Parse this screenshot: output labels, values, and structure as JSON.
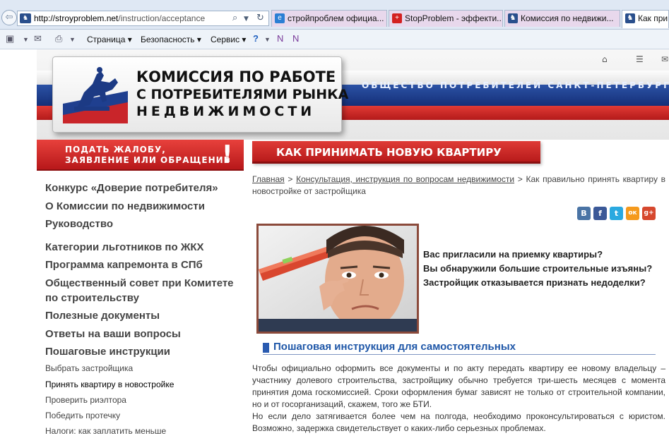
{
  "browser": {
    "address": {
      "url_domain": "http://stroyproblem.net",
      "url_path": "/instruction/acceptance"
    },
    "tabs": [
      {
        "label": "стройпроблем официа...",
        "icon": "ie-icon",
        "color": "#e8d8ec"
      },
      {
        "label": "StopProblem - эффекти...",
        "icon": "swiss-cross-icon",
        "color": "#e8d8ec"
      },
      {
        "label": "Комиссия по недвижи...",
        "icon": "horseman-icon",
        "color": "#e8d8ec"
      },
      {
        "label": "Как прини",
        "icon": "horseman-icon",
        "color": "#ffffff"
      }
    ],
    "commands": {
      "page": "Страница",
      "security": "Безопасность",
      "service": "Сервис"
    }
  },
  "header": {
    "logo_line1": "КОМИССИЯ ПО РАБОТЕ",
    "logo_line2": "С ПОТРЕБИТЕЛЯМИ РЫНКА",
    "logo_line3": "НЕДВИЖИМОСТИ",
    "tagline": "ОБЩЕСТВО ПОТРЕБИТЕЛЕЙ САНКТ-ПЕТЕРБУРГА И"
  },
  "sidebar": {
    "complaint_line1": "ПОДАТЬ ЖАЛОБУ,",
    "complaint_line2": "ЗАЯВЛЕНИЕ ИЛИ ОБРАЩЕНИЕ",
    "complaint_mark": "!",
    "links": [
      "Конкурс «Доверие потребителя»",
      "О Комиссии по недвижимости",
      "Руководство",
      "Категории льготников по ЖКХ",
      "Программа капремонта в СПб",
      "Общественный совет при Комитете",
      "по строительству",
      "Полезные документы",
      "Ответы на ваши вопросы",
      "Пошаговые инструкции"
    ],
    "sublinks": [
      "Выбрать застройщика",
      "Принять квартиру в новостройке",
      "Проверить риэлтора",
      "Победить протечку",
      "Налоги: как заплатить меньше"
    ]
  },
  "main": {
    "title": "КАК ПРИНИМАТЬ НОВУЮ КВАРТИРУ",
    "breadcrumb": {
      "home": "Главная",
      "sep": ">",
      "section": "Консультация, инструкция по вопросам недвижимости",
      "current": "Как правильно принять квартиру в новостройке от застройщика"
    },
    "share": [
      "В",
      "f",
      "t",
      "ок",
      "g+"
    ],
    "questions": [
      "Вас пригласили на приемку квартиры?",
      "Вы обнаружили большие строительные изъяны?",
      "Застройщик отказывается признать недоделки?"
    ],
    "section_heading": "Пошаговая инструкция для самостоятельных",
    "paragraph1": "Чтобы официально оформить все документы и по акту передать квартиру ее новому владельцу – участнику долевого строительства, застройщику обычно требуется три-шесть месяцев с момента принятия дома госкомиссией. Сроки оформления бумаг зависят не только от строительной компании, но и от госорганизаций, скажем, того же БТИ.",
    "paragraph2": "Но если дело затягивается более чем на полгода, необходимо проконсультироваться с юристом. Возможно, задержка свидетельствует о каких-либо серьезных проблемах."
  }
}
